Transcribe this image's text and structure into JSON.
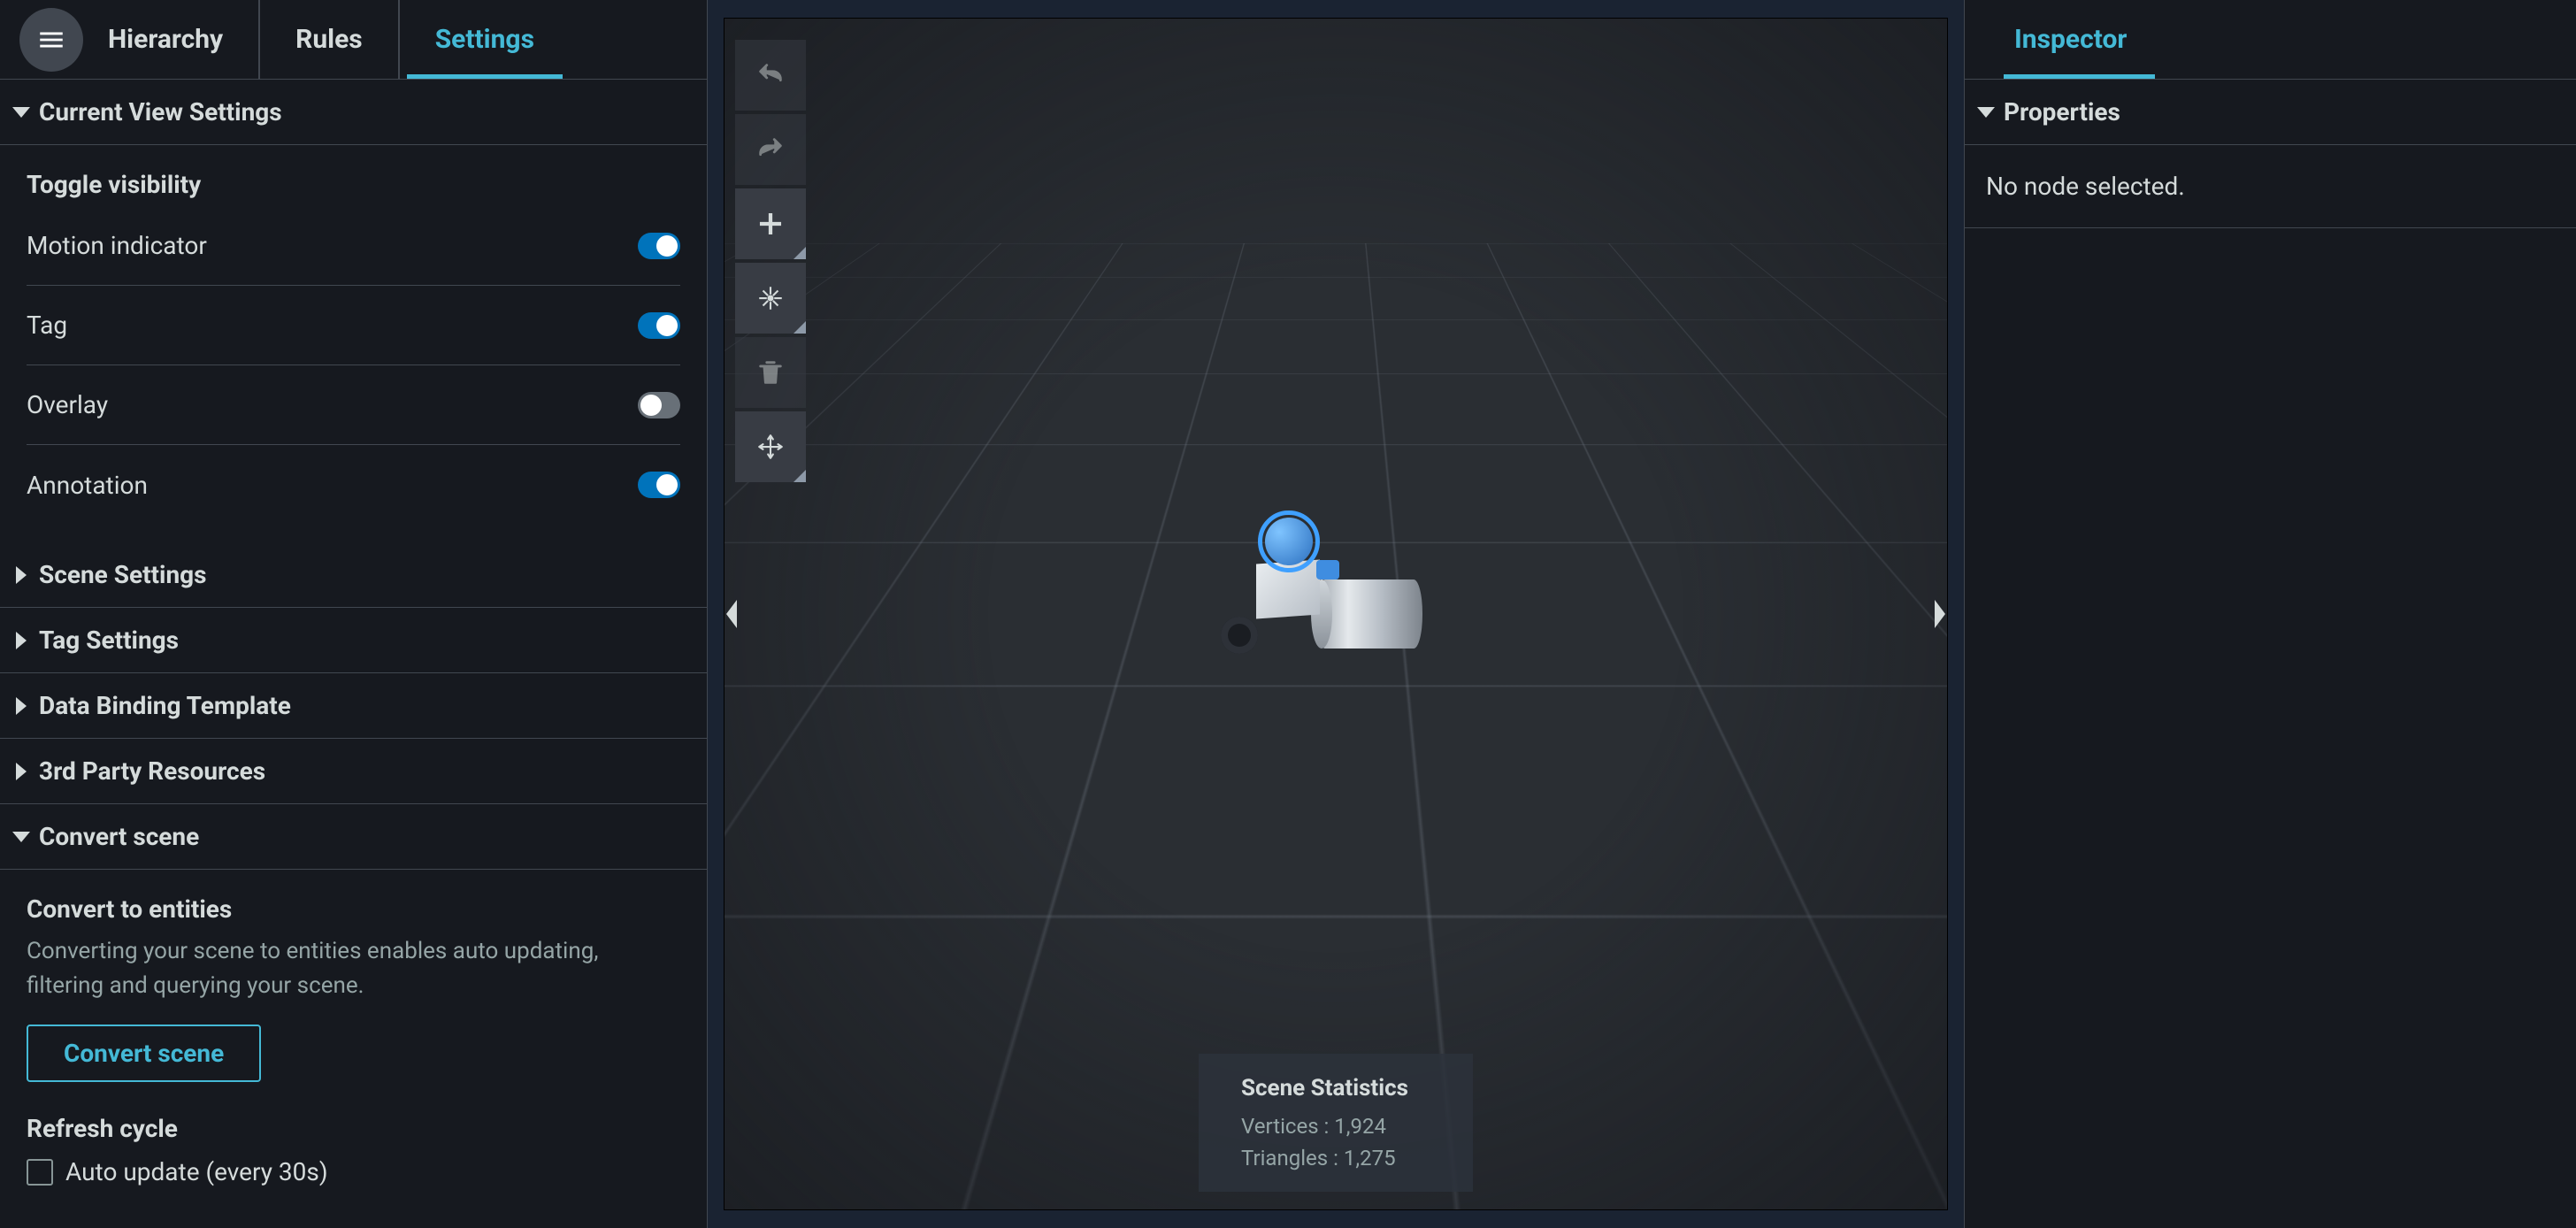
{
  "left": {
    "tabs": [
      "Hierarchy",
      "Rules",
      "Settings"
    ],
    "activeTab": "Settings",
    "sections": {
      "currentView": {
        "title": "Current View Settings",
        "expanded": true,
        "subheading": "Toggle visibility",
        "toggles": [
          {
            "label": "Motion indicator",
            "on": true
          },
          {
            "label": "Tag",
            "on": true
          },
          {
            "label": "Overlay",
            "on": false
          },
          {
            "label": "Annotation",
            "on": true
          }
        ]
      },
      "sceneSettings": {
        "title": "Scene Settings",
        "expanded": false
      },
      "tagSettings": {
        "title": "Tag Settings",
        "expanded": false
      },
      "dataBinding": {
        "title": "Data Binding Template",
        "expanded": false
      },
      "thirdParty": {
        "title": "3rd Party Resources",
        "expanded": false
      },
      "convert": {
        "title": "Convert scene",
        "expanded": true,
        "subheading": "Convert to entities",
        "description": "Converting your scene to entities enables auto updating, filtering and querying your scene.",
        "buttonLabel": "Convert scene",
        "refreshHeading": "Refresh cycle",
        "autoUpdateLabel": "Auto update (every 30s)",
        "autoUpdateChecked": false
      }
    }
  },
  "viewport": {
    "stats": {
      "title": "Scene Statistics",
      "verticesLabel": "Vertices",
      "vertices": "1,924",
      "trianglesLabel": "Triangles",
      "triangles": "1,275"
    }
  },
  "right": {
    "tabs": [
      "Inspector"
    ],
    "activeTab": "Inspector",
    "propertiesTitle": "Properties",
    "emptyMessage": "No node selected."
  }
}
